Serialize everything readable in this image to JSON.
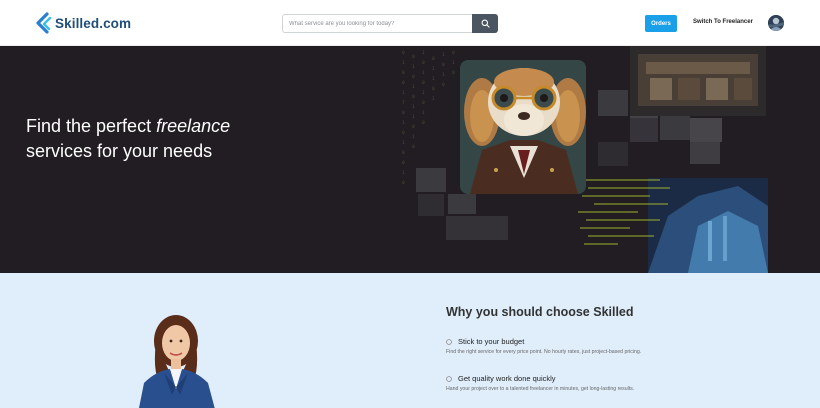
{
  "nav": {
    "logo_text": "Skilled.com",
    "search_placeholder": "What service are you looking for today?",
    "orders_label": "Orders",
    "switch_label": "Switch To Freelancer"
  },
  "hero": {
    "title_part1": "Find the perfect ",
    "title_italic": "freelance",
    "title_part2": "services for your needs"
  },
  "why": {
    "title": "Why you should choose Skilled",
    "points": [
      {
        "title": "Stick to your budget",
        "desc": "Find the right service for every price point. No hourly rates, just project-based pricing."
      },
      {
        "title": "Get quality work done quickly",
        "desc": "Hand your project over to a talented freelancer in minutes, get long-lasting results."
      }
    ]
  },
  "colors": {
    "brand": "#1f4e7a",
    "accent": "#1aa0e8",
    "hero_bg": "#211d22",
    "section_bg": "#e0eefb"
  },
  "icons": [
    "search-icon",
    "check-icon",
    "logo-mark"
  ]
}
